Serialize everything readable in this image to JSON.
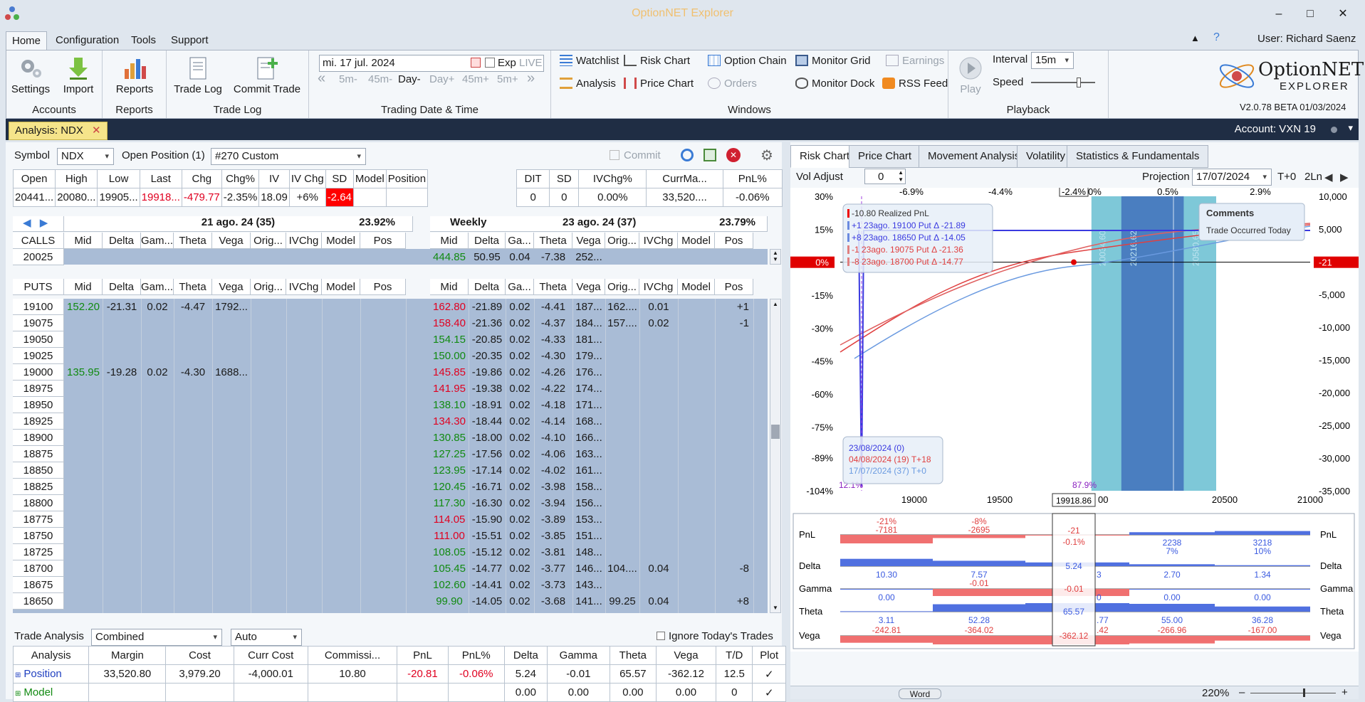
{
  "window": {
    "title": "OptionNET Explorer",
    "min": "–",
    "max": "□",
    "close": "✕"
  },
  "menu": {
    "items": [
      "Home",
      "Configuration",
      "Tools",
      "Support"
    ],
    "user": "User: Richard Saenz"
  },
  "ribbon": {
    "accounts": {
      "label": "Accounts",
      "settings": "Settings",
      "import": "Import"
    },
    "reports": {
      "label": "Reports",
      "reports": "Reports"
    },
    "tradelog": {
      "label": "Trade Log",
      "tradelog": "Trade Log",
      "commit": "Commit Trade"
    },
    "datetime": {
      "label": "Trading Date & Time",
      "date": "mi. 17 jul. 2024",
      "exp": "Exp",
      "live": "LIVE",
      "steps": [
        "5m-",
        "45m-",
        "Day-",
        "Day+",
        "45m+",
        "5m+"
      ]
    },
    "windows": {
      "label": "Windows",
      "watchlist": "Watchlist",
      "risk_chart": "Risk Chart",
      "option_chain": "Option Chain",
      "monitor_grid": "Monitor Grid",
      "earnings": "Earnings",
      "analysis": "Analysis",
      "price_chart": "Price Chart",
      "orders": "Orders",
      "monitor_dock": "Monitor Dock",
      "rss": "RSS Feed"
    },
    "playback": {
      "label": "Playback",
      "play": "Play",
      "interval_label": "Interval",
      "interval": "15m",
      "speed": "Speed"
    },
    "logo": {
      "line1": "OptionNET",
      "line2": "EXPLORER",
      "version": "V2.0.78 BETA 01/03/2024"
    }
  },
  "tabbar": {
    "doc_tab": "Analysis: NDX",
    "close": "✕",
    "account": "Account: VXN 19"
  },
  "left": {
    "symbol_label": "Symbol",
    "symbol": "NDX",
    "open_pos_label": "Open Position (1)",
    "position": "#270 Custom",
    "commit": "Commit",
    "quote": {
      "headers": [
        "Open",
        "High",
        "Low",
        "Last",
        "Chg",
        "Chg%",
        "IV",
        "IV Chg",
        "SD",
        "Model",
        "Position"
      ],
      "values": [
        "20441...",
        "20080...",
        "19905...",
        "19918...",
        "-479.77",
        "-2.35%",
        "18.09",
        "+6%",
        "-2.64",
        "",
        ""
      ]
    },
    "summary": {
      "headers": [
        "DIT",
        "SD",
        "IVChg%",
        "CurrMa...",
        "PnL%"
      ],
      "values": [
        "0",
        "0",
        "0.00%",
        "33,520....",
        "-0.06%"
      ]
    },
    "exp1": {
      "title": "21 ago. 24 (35)",
      "iv": "23.92%"
    },
    "exp2": {
      "weekly": "Weekly",
      "title": "23 ago. 24 (37)",
      "iv": "23.79%"
    },
    "cols1": [
      "Mid",
      "Delta",
      "Gam...",
      "Theta",
      "Vega",
      "Orig...",
      "IVChg",
      "Model",
      "Pos"
    ],
    "cols2": [
      "Mid",
      "Delta",
      "Ga...",
      "Theta",
      "Vega",
      "Orig...",
      "IVChg",
      "Model",
      "Pos"
    ],
    "calls_label": "CALLS",
    "puts_label": "PUTS",
    "call_row": {
      "strike": "20025",
      "mid": "444.85",
      "delta": "50.95",
      "gamma": "0.04",
      "theta": "-7.38",
      "vega": "252..."
    },
    "puts": [
      {
        "k": "19100",
        "m1": "152.20",
        "d1": "-21.31",
        "g1": "0.02",
        "t1": "-4.47",
        "v1": "1792...",
        "m2": "162.80",
        "c2": "red",
        "d2": "-21.89",
        "g2": "0.02",
        "t2": "-4.41",
        "v2": "187...",
        "o2": "162....",
        "iv2": "0.01",
        "p2": "+1"
      },
      {
        "k": "19075",
        "m2": "158.40",
        "c2": "red",
        "d2": "-21.36",
        "g2": "0.02",
        "t2": "-4.37",
        "v2": "184...",
        "o2": "157....",
        "iv2": "0.02",
        "p2": "-1"
      },
      {
        "k": "19050",
        "m2": "154.15",
        "c2": "green",
        "d2": "-20.85",
        "g2": "0.02",
        "t2": "-4.33",
        "v2": "181..."
      },
      {
        "k": "19025",
        "m2": "150.00",
        "c2": "green",
        "d2": "-20.35",
        "g2": "0.02",
        "t2": "-4.30",
        "v2": "179..."
      },
      {
        "k": "19000",
        "m1": "135.95",
        "d1": "-19.28",
        "g1": "0.02",
        "t1": "-4.30",
        "v1": "1688...",
        "m2": "145.85",
        "c2": "red",
        "d2": "-19.86",
        "g2": "0.02",
        "t2": "-4.26",
        "v2": "176..."
      },
      {
        "k": "18975",
        "m2": "141.95",
        "c2": "red",
        "d2": "-19.38",
        "g2": "0.02",
        "t2": "-4.22",
        "v2": "174..."
      },
      {
        "k": "18950",
        "m2": "138.10",
        "c2": "green",
        "d2": "-18.91",
        "g2": "0.02",
        "t2": "-4.18",
        "v2": "171..."
      },
      {
        "k": "18925",
        "m2": "134.30",
        "c2": "red",
        "d2": "-18.44",
        "g2": "0.02",
        "t2": "-4.14",
        "v2": "168..."
      },
      {
        "k": "18900",
        "m2": "130.85",
        "c2": "green",
        "d2": "-18.00",
        "g2": "0.02",
        "t2": "-4.10",
        "v2": "166..."
      },
      {
        "k": "18875",
        "m2": "127.25",
        "c2": "green",
        "d2": "-17.56",
        "g2": "0.02",
        "t2": "-4.06",
        "v2": "163..."
      },
      {
        "k": "18850",
        "m2": "123.95",
        "c2": "green",
        "d2": "-17.14",
        "g2": "0.02",
        "t2": "-4.02",
        "v2": "161..."
      },
      {
        "k": "18825",
        "m2": "120.45",
        "c2": "green",
        "d2": "-16.71",
        "g2": "0.02",
        "t2": "-3.98",
        "v2": "158..."
      },
      {
        "k": "18800",
        "m2": "117.30",
        "c2": "green",
        "d2": "-16.30",
        "g2": "0.02",
        "t2": "-3.94",
        "v2": "156..."
      },
      {
        "k": "18775",
        "m2": "114.05",
        "c2": "red",
        "d2": "-15.90",
        "g2": "0.02",
        "t2": "-3.89",
        "v2": "153..."
      },
      {
        "k": "18750",
        "m2": "111.00",
        "c2": "red",
        "d2": "-15.51",
        "g2": "0.02",
        "t2": "-3.85",
        "v2": "151..."
      },
      {
        "k": "18725",
        "m2": "108.05",
        "c2": "green",
        "d2": "-15.12",
        "g2": "0.02",
        "t2": "-3.81",
        "v2": "148..."
      },
      {
        "k": "18700",
        "m2": "105.45",
        "c2": "green",
        "d2": "-14.77",
        "g2": "0.02",
        "t2": "-3.77",
        "v2": "146...",
        "o2": "104....",
        "iv2": "0.04",
        "p2": "-8"
      },
      {
        "k": "18675",
        "m2": "102.60",
        "c2": "green",
        "d2": "-14.41",
        "g2": "0.02",
        "t2": "-3.73",
        "v2": "143..."
      },
      {
        "k": "18650",
        "m2": "99.90",
        "c2": "green",
        "d2": "-14.05",
        "g2": "0.02",
        "t2": "-3.68",
        "v2": "141...",
        "o2": "99.25",
        "iv2": "0.04",
        "p2": "+8"
      }
    ],
    "trade_analysis": {
      "label": "Trade Analysis",
      "mode": "Combined",
      "auto": "Auto",
      "ignore": "Ignore Today's Trades",
      "headers": [
        "Analysis",
        "Margin",
        "Cost",
        "Curr Cost",
        "Commissi...",
        "PnL",
        "PnL%",
        "Delta",
        "Gamma",
        "Theta",
        "Vega",
        "T/D",
        "Plot"
      ],
      "rows": [
        [
          "Position",
          "33,520.80",
          "3,979.20",
          "-4,000.01",
          "10.80",
          "-20.81",
          "-0.06%",
          "5.24",
          "-0.01",
          "65.57",
          "-362.12",
          "12.5",
          "✓"
        ],
        [
          "Model",
          "",
          "",
          "",
          "",
          "",
          "",
          "0.00",
          "0.00",
          "0.00",
          "0.00",
          "0",
          "✓"
        ]
      ]
    }
  },
  "right": {
    "tabs": [
      "Risk Chart",
      "Price Chart",
      "Movement Analysis",
      "Volatility",
      "Statistics & Fundamentals"
    ],
    "vol_adjust_label": "Vol Adjust",
    "vol_adjust": "0",
    "projection_label": "Projection",
    "projection": "17/07/2024",
    "t0": "T+0",
    "lines": "2Ln",
    "top_axis": [
      "-6.9%",
      "-4.4%",
      "-2.4%",
      "0.5%",
      "2.9%"
    ],
    "top_axis_extra": "0%",
    "left_axis": [
      "30%",
      "15%",
      "0%",
      "-15%",
      "-30%",
      "-45%",
      "-60%",
      "-75%",
      "-89%",
      "-104%"
    ],
    "right_axis": [
      "10,000",
      "5,000",
      "-21",
      "-5,000",
      "-10,000",
      "-15,000",
      "-20,000",
      "-25,000",
      "-30,000",
      "-35,000"
    ],
    "x_axis": [
      "19000",
      "19500",
      "19918.86",
      "20500",
      "21000"
    ],
    "x_axis_partial": "00",
    "band_labels": [
      "20034.60",
      "20216.62",
      "20580.65"
    ],
    "legend": [
      "-10.80 Realized PnL",
      "+1 23ago. 19100 Put Δ -21.89",
      "+8 23ago. 18650 Put Δ -14.05",
      "-1 23ago. 19075 Put Δ -21.36",
      "-8 23ago. 18700 Put Δ -14.77"
    ],
    "legend_marks": [
      "",
      "+1",
      "+8",
      "-1",
      "-8"
    ],
    "comments": {
      "title": "Comments",
      "text": "Trade Occurred Today"
    },
    "dates": [
      "23/08/2024 (0)",
      "04/08/2024 (19) T+18",
      "17/07/2024 (37) T+0"
    ],
    "pct_left": "12.1%",
    "pct_right": "87.9%",
    "greeks": {
      "labels": [
        "PnL",
        "Delta",
        "Gamma",
        "Theta",
        "Vega"
      ],
      "pnl_top": [
        "-21%",
        "-8%"
      ],
      "pnl_vals": [
        "-7181",
        "-2695",
        "2238",
        "3218"
      ],
      "pnl_pct": [
        "7%",
        "10%"
      ],
      "delta": [
        "10.30",
        "7.57",
        "5.24",
        "",
        "2.70",
        "1.34"
      ],
      "gamma": [
        "0.00",
        "-0.01",
        "-0.01",
        "",
        "0.00",
        "0.00"
      ],
      "theta": [
        "3.11",
        "52.28",
        "65.57",
        "",
        "55.00",
        "36.28"
      ],
      "vega": [
        "-242.81",
        "-364.02",
        "-362.12",
        "",
        "-266.96",
        "-167.00"
      ],
      "cursor": {
        "pnl": "-21",
        "pnlpct": "-0.1%"
      },
      "partials": {
        "delta": "3",
        "gamma": "0",
        "theta": ".77",
        "vega": ".42"
      }
    },
    "word": "Word",
    "zoom": "220%"
  }
}
